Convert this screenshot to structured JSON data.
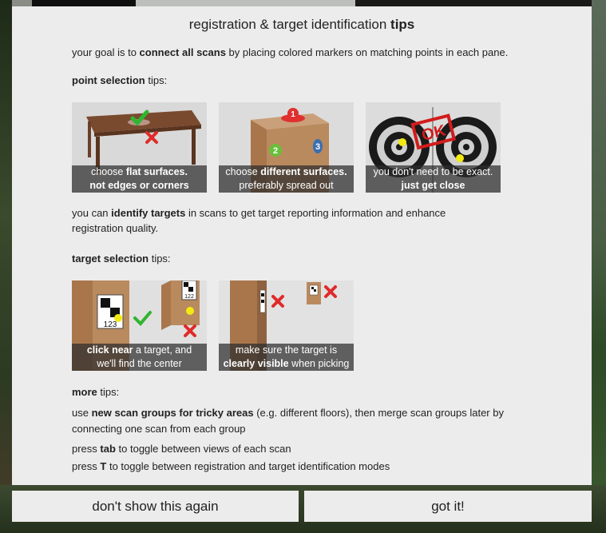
{
  "dialog": {
    "title_prefix": "registration & target identification ",
    "title_bold": "tips",
    "goal": {
      "pre": "your goal is to ",
      "bold": "connect all scans",
      "post": " by placing colored markers on matching points in each pane."
    },
    "point_heading": {
      "bold": "point selection",
      "post": " tips:"
    },
    "point_tiles": [
      {
        "line1_pre": "choose ",
        "line1_bold": "flat surfaces.",
        "line2_bold": "not edges or corners",
        "line2_normal": ""
      },
      {
        "line1_pre": "choose ",
        "line1_bold": "different surfaces.",
        "line2_bold": "",
        "line2_normal": "preferably spread out"
      },
      {
        "line1_pre": "you don't need to be exact.",
        "line1_bold": "",
        "line2_bold": "just get close",
        "line2_normal": ""
      }
    ],
    "identify": {
      "pre": "you can ",
      "bold": "identify targets",
      "post": " in scans to get target reporting information and enhance",
      "line2": "registration quality."
    },
    "target_heading": {
      "bold": "target selection",
      "post": " tips:"
    },
    "target_tiles": [
      {
        "line1_bold": "click near",
        "line1_post": " a target, and",
        "line2_pre": "",
        "line2_bold": "",
        "line2_post": "we'll find the center"
      },
      {
        "line1_bold": "",
        "line1_post": "make sure the target is",
        "line2_pre": "",
        "line2_bold": "clearly visible",
        "line2_post": " when picking"
      }
    ],
    "more_heading": {
      "bold": "more",
      "post": " tips:"
    },
    "more": {
      "groups_pre": "use ",
      "groups_bold": "new scan groups for tricky areas",
      "groups_post": " (e.g. different floors), then merge scan groups later by",
      "groups_line2": "connecting one scan from each group",
      "tab_pre": "press ",
      "tab_bold": "tab",
      "tab_post": " to toggle between views of each scan",
      "t_pre": "press ",
      "t_bold": "T",
      "t_post": " to toggle between registration and target identification modes"
    }
  },
  "buttons": {
    "dont_show": "don't show this again",
    "got_it": "got it!"
  },
  "markers": {
    "n1": "1",
    "n2": "2",
    "n3": "3",
    "ok": "OK",
    "target_num": "123",
    "target_num_small": "122"
  },
  "colors": {
    "check": "#2fb52f",
    "cross": "#e02a2a",
    "marker_yellow": "#f2ea10",
    "box": "#b98a5e"
  }
}
